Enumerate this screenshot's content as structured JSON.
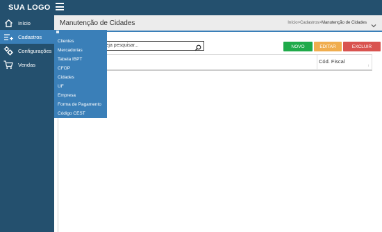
{
  "app": {
    "logo": "SUA LOGO"
  },
  "sidebar": {
    "items": [
      {
        "label": "Início",
        "icon": "home-icon"
      },
      {
        "label": "Cadastros",
        "icon": "add-list-icon"
      },
      {
        "label": "Configurações",
        "icon": "gears-icon"
      },
      {
        "label": "Vendas",
        "icon": "cart-icon"
      }
    ]
  },
  "dropdown": {
    "items": [
      "Clientes",
      "Mercadorias",
      "Tabela IBPT",
      "CFOP",
      "Cidades",
      "UF",
      "Empresa",
      "Forma de Pagamento",
      "Código CEST"
    ]
  },
  "header": {
    "title": "Manutenção de Cidades",
    "breadcrumb_start": "Início>Cadastros>",
    "breadcrumb_current": "Manutenção de Cidades"
  },
  "search": {
    "placeholder_visible": "seja pesquisar..."
  },
  "buttons": {
    "novo": "NOVO",
    "editar": "EDITAR",
    "excluir": "EXCLUIR"
  },
  "table": {
    "columns": [
      "Cód. Fiscal"
    ],
    "sort_indicator": "↑"
  },
  "colors": {
    "sidebar": "#24506e",
    "accent": "#3a7fb8",
    "novo": "#1faa4a",
    "editar": "#f0ad4e",
    "excluir": "#d9534f"
  }
}
